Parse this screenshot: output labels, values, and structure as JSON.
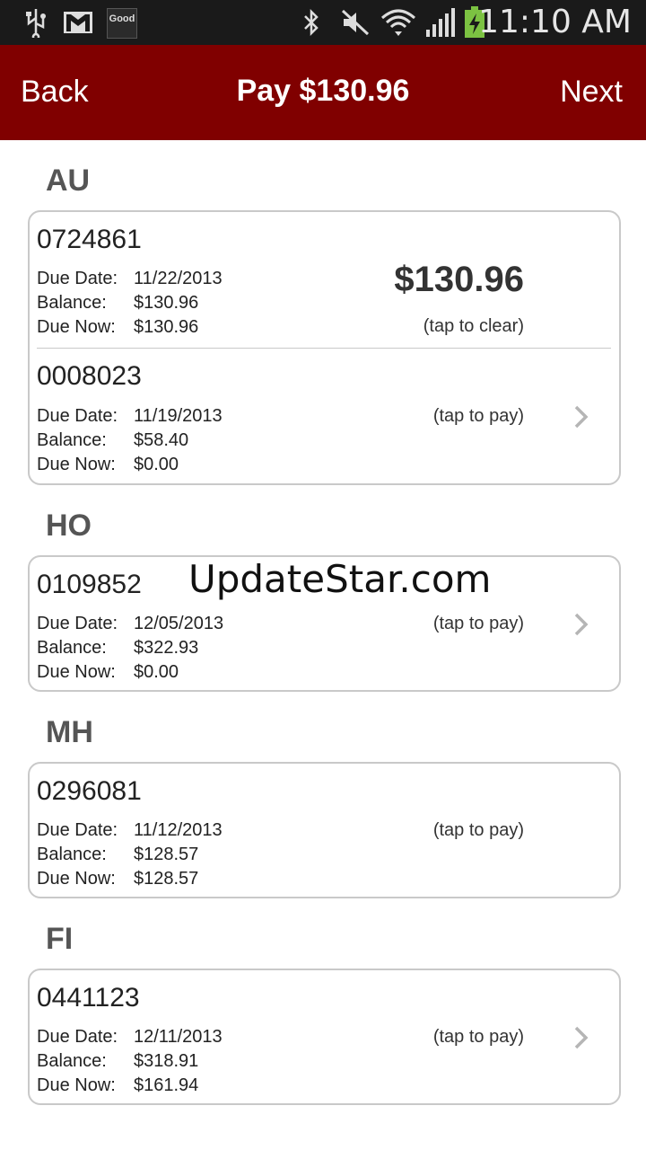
{
  "status_bar": {
    "time": "11:10 AM",
    "good_badge": "Good",
    "icons": [
      "usb-icon",
      "gmail-icon",
      "good-icon",
      "bluetooth-icon",
      "mute-icon",
      "wifi-icon",
      "signal-icon",
      "battery-charging-icon"
    ]
  },
  "header": {
    "back_label": "Back",
    "title": "Pay $130.96",
    "next_label": "Next"
  },
  "labels": {
    "due_date": "Due Date:",
    "balance": "Balance:",
    "due_now": "Due Now:",
    "tap_to_pay": "(tap to pay)",
    "tap_to_clear": "(tap to clear)"
  },
  "sections": [
    {
      "title": "AU",
      "accounts": [
        {
          "number": "0724861",
          "due_date": "11/22/2013",
          "balance": "$130.96",
          "due_now": "$130.96",
          "selected_amount": "$130.96"
        },
        {
          "number": "0008023",
          "due_date": "11/19/2013",
          "balance": "$58.40",
          "due_now": "$0.00"
        }
      ]
    },
    {
      "title": "HO",
      "accounts": [
        {
          "number": "0109852",
          "due_date": "12/05/2013",
          "balance": "$322.93",
          "due_now": "$0.00"
        }
      ]
    },
    {
      "title": "MH",
      "accounts": [
        {
          "number": "0296081",
          "due_date": "11/12/2013",
          "balance": "$128.57",
          "due_now": "$128.57"
        }
      ]
    },
    {
      "title": "FI",
      "accounts": [
        {
          "number": "0441123",
          "due_date": "12/11/2013",
          "balance": "$318.91",
          "due_now": "$161.94"
        }
      ]
    }
  ],
  "watermark": "UpdateStar.com",
  "colors": {
    "header_bg": "#800000",
    "status_bg": "#1a1a1a",
    "battery": "#7cc242"
  }
}
